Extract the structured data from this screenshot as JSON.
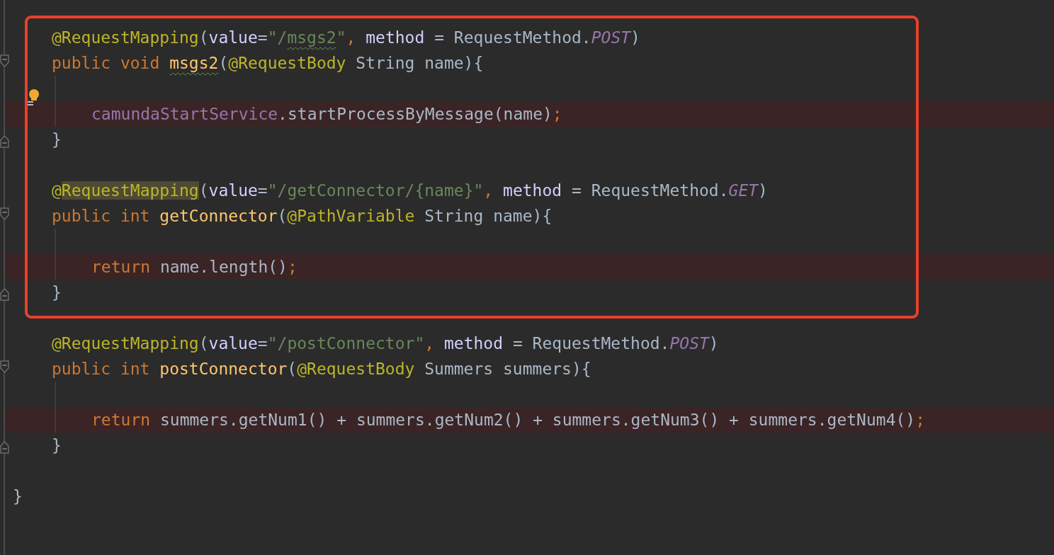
{
  "editor": {
    "sections": [
      {
        "framed": true,
        "lines": [
          {
            "kind": "member",
            "highlighted": false,
            "tokens": [
              {
                "text": "@RequestMapping",
                "kind": "annotation"
              },
              {
                "text": "(",
                "kind": "plain"
              },
              {
                "text": "value",
                "kind": "param"
              },
              {
                "text": "=",
                "kind": "plain"
              },
              {
                "text": "\"/",
                "kind": "string"
              },
              {
                "text": "msgs2",
                "kind": "warnstring"
              },
              {
                "text": "\"",
                "kind": "string"
              },
              {
                "text": ", ",
                "kind": "keyword"
              },
              {
                "text": "method",
                "kind": "param"
              },
              {
                "text": " = RequestMethod.",
                "kind": "plain"
              },
              {
                "text": "POST",
                "kind": "constant"
              },
              {
                "text": ")",
                "kind": "plain"
              }
            ]
          },
          {
            "kind": "header",
            "highlighted": false,
            "tokens": [
              {
                "text": "public void ",
                "kind": "keyword"
              },
              {
                "text": "msgs2",
                "kind": "warnmethod"
              },
              {
                "text": "(",
                "kind": "plain"
              },
              {
                "text": "@RequestBody",
                "kind": "annotation"
              },
              {
                "text": " String name){",
                "kind": "plain"
              }
            ]
          },
          {
            "kind": "blank",
            "highlighted": false
          },
          {
            "kind": "body",
            "highlighted": true,
            "bulb": true,
            "tokens": [
              {
                "text": "camundaStartService",
                "kind": "field"
              },
              {
                "text": ".startProcessByMessage(name)",
                "kind": "plain"
              },
              {
                "text": ";",
                "kind": "keyword"
              }
            ]
          },
          {
            "kind": "close",
            "highlighted": false,
            "tokens": [
              {
                "text": "}",
                "kind": "plain"
              }
            ]
          },
          {
            "kind": "blank",
            "highlighted": false
          },
          {
            "kind": "member",
            "highlighted": false,
            "tokens": [
              {
                "text": "@",
                "kind": "annotation"
              },
              {
                "text": "RequestMapping",
                "kind": "usageannotation"
              },
              {
                "text": "(",
                "kind": "plain"
              },
              {
                "text": "value",
                "kind": "param"
              },
              {
                "text": "=",
                "kind": "plain"
              },
              {
                "text": "\"/getConnector/{name}\"",
                "kind": "string"
              },
              {
                "text": ", ",
                "kind": "keyword"
              },
              {
                "text": "method",
                "kind": "param"
              },
              {
                "text": " = RequestMethod.",
                "kind": "plain"
              },
              {
                "text": "GET",
                "kind": "constant"
              },
              {
                "text": ")",
                "kind": "plain"
              }
            ]
          },
          {
            "kind": "header",
            "highlighted": false,
            "tokens": [
              {
                "text": "public int ",
                "kind": "keyword"
              },
              {
                "text": "getConnector",
                "kind": "method"
              },
              {
                "text": "(",
                "kind": "plain"
              },
              {
                "text": "@PathVariable",
                "kind": "annotation"
              },
              {
                "text": " String name){",
                "kind": "plain"
              }
            ]
          },
          {
            "kind": "blank",
            "highlighted": false
          },
          {
            "kind": "body",
            "highlighted": true,
            "tokens": [
              {
                "text": "return ",
                "kind": "keyword"
              },
              {
                "text": "name.length()",
                "kind": "plain"
              },
              {
                "text": ";",
                "kind": "keyword"
              }
            ]
          },
          {
            "kind": "close",
            "highlighted": false,
            "tokens": [
              {
                "text": "}",
                "kind": "plain"
              }
            ]
          }
        ]
      },
      {
        "framed": false,
        "lines": [
          {
            "kind": "blank",
            "highlighted": false
          },
          {
            "kind": "member",
            "highlighted": false,
            "tokens": [
              {
                "text": "@RequestMapping",
                "kind": "annotation"
              },
              {
                "text": "(",
                "kind": "plain"
              },
              {
                "text": "value",
                "kind": "param"
              },
              {
                "text": "=",
                "kind": "plain"
              },
              {
                "text": "\"/postConnector\"",
                "kind": "string"
              },
              {
                "text": ", ",
                "kind": "keyword"
              },
              {
                "text": "method",
                "kind": "param"
              },
              {
                "text": " = RequestMethod.",
                "kind": "plain"
              },
              {
                "text": "POST",
                "kind": "constant"
              },
              {
                "text": ")",
                "kind": "plain"
              }
            ]
          },
          {
            "kind": "header",
            "highlighted": false,
            "tokens": [
              {
                "text": "public int ",
                "kind": "keyword"
              },
              {
                "text": "postConnector",
                "kind": "method"
              },
              {
                "text": "(",
                "kind": "plain"
              },
              {
                "text": "@RequestBody",
                "kind": "annotation"
              },
              {
                "text": " Summers summers){",
                "kind": "plain"
              }
            ]
          },
          {
            "kind": "blank",
            "highlighted": false
          },
          {
            "kind": "body",
            "highlighted": true,
            "tokens": [
              {
                "text": "return ",
                "kind": "keyword"
              },
              {
                "text": "summers.getNum1() + summers.getNum2() + summers.getNum3() + summers.getNum4()",
                "kind": "plain"
              },
              {
                "text": ";",
                "kind": "keyword"
              }
            ]
          },
          {
            "kind": "close",
            "highlighted": false,
            "tokens": [
              {
                "text": "}",
                "kind": "plain"
              }
            ]
          },
          {
            "kind": "blank",
            "highlighted": false
          },
          {
            "kind": "top",
            "highlighted": false,
            "tokens": [
              {
                "text": "}",
                "kind": "plain"
              }
            ]
          }
        ]
      }
    ]
  }
}
